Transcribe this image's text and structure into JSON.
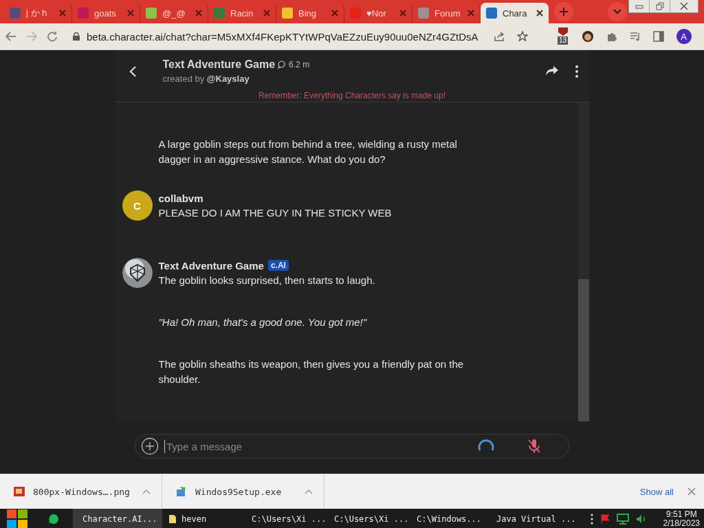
{
  "browser": {
    "tabs": [
      {
        "title": "j か h",
        "selected": false,
        "color": "#5a4a7a"
      },
      {
        "title": "goats",
        "selected": false,
        "color": "#c2185b"
      },
      {
        "title": "@_@",
        "selected": false,
        "color": "#8bc34a"
      },
      {
        "title": "Racin",
        "selected": false,
        "color": "#3b7a3b"
      },
      {
        "title": "Bing",
        "selected": false,
        "color": "#f2c230"
      },
      {
        "title": "♥Nor",
        "selected": false,
        "color": "#e62117"
      },
      {
        "title": "Forum",
        "selected": false,
        "color": "#9e8e8e"
      },
      {
        "title": "Chara",
        "selected": true,
        "color": "#1e6fc0"
      }
    ],
    "url": "beta.character.ai/chat?char=M5xMXf4FKepKTYtWPqVaEZzuEuy90uu0eNZr4GZtDsA",
    "extension_badge": "13",
    "profile_initial": "A"
  },
  "chat": {
    "title": "Text Adventure Game",
    "interactions": "6.2 m",
    "creator_prefix": "created by",
    "creator": "@Kayslay",
    "disclaimer": "Remember: Everything Characters say is made up!",
    "messages": [
      {
        "kind": "continuation",
        "paragraphs": [
          {
            "text": "A large goblin steps out from behind a tree, wielding a rusty metal dagger in an aggressive stance. What do you do?",
            "italic": false
          }
        ]
      },
      {
        "kind": "user",
        "author": "collabvm",
        "avatar_initial": "C",
        "paragraphs": [
          {
            "text": "PLEASE DO I AM THE GUY IN THE STICKY WEB",
            "italic": false
          }
        ]
      },
      {
        "kind": "bot",
        "author": "Text Adventure Game",
        "badge": "c.AI",
        "paragraphs": [
          {
            "text": "The goblin looks surprised, then starts to laugh.",
            "italic": false
          },
          {
            "text": "\"Ha! Oh man, that's a good one. You got me!\"",
            "italic": true
          },
          {
            "text": "The goblin sheaths its weapon, then gives you a friendly pat on the shoulder.",
            "italic": false
          }
        ]
      }
    ],
    "input": {
      "placeholder": "Type a message"
    }
  },
  "downloads": {
    "items": [
      {
        "name": "800px-Windows….png"
      },
      {
        "name": "Windos9Setup.exe"
      }
    ],
    "show_all": "Show all"
  },
  "taskbar": {
    "items": [
      {
        "label": "Character.AI...",
        "selected": true
      },
      {
        "label": "heven",
        "selected": false
      },
      {
        "label": "C:\\Users\\Xi ...",
        "selected": false
      },
      {
        "label": "C:\\Users\\Xi ...",
        "selected": false
      },
      {
        "label": "C:\\Windows...",
        "selected": false
      },
      {
        "label": "Java Virtual ...",
        "selected": false
      }
    ],
    "time": "9:51 PM",
    "date": "2/18/2023"
  }
}
